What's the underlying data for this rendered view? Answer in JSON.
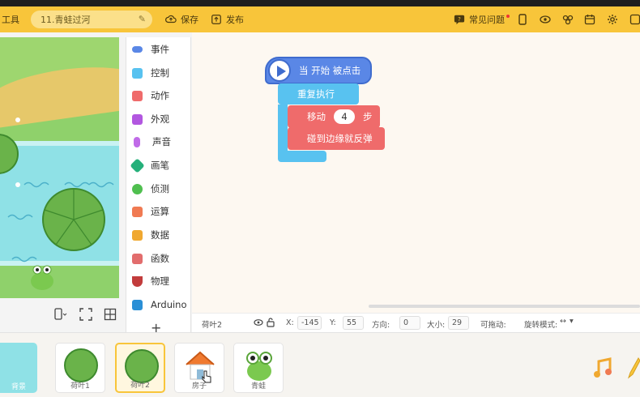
{
  "toolbar": {
    "tools_label": "工具",
    "project_name": "11.青蛙过河",
    "save_label": "保存",
    "publish_label": "发布",
    "faq_label": "常见问题"
  },
  "categories": [
    {
      "label": "事件",
      "color": "#5a87e6"
    },
    {
      "label": "控制",
      "color": "#58c2f0"
    },
    {
      "label": "动作",
      "color": "#ef6b6b"
    },
    {
      "label": "外观",
      "color": "#b257e0"
    },
    {
      "label": "声音",
      "color": "#c06be8"
    },
    {
      "label": "画笔",
      "color": "#25b07a"
    },
    {
      "label": "侦测",
      "color": "#4fbf4f"
    },
    {
      "label": "运算",
      "color": "#f07a52"
    },
    {
      "label": "数据",
      "color": "#f0a830"
    },
    {
      "label": "函数",
      "color": "#e26d6d"
    },
    {
      "label": "物理",
      "color": "#c23c3c"
    },
    {
      "label": "Arduino",
      "color": "#2a8fd6"
    }
  ],
  "blocks": {
    "when_start": "当 开始 被点击",
    "repeat": "重复执行",
    "move_prefix": "移动",
    "move_steps": "4",
    "move_suffix": "步",
    "bounce": "碰到边缘就反弹"
  },
  "properties": {
    "sprite_name": "荷叶2",
    "x_label": "X:",
    "x_value": "-145",
    "y_label": "Y:",
    "y_value": "55",
    "direction_label": "方向:",
    "direction_value": "0",
    "size_label": "大小:",
    "size_value": "29",
    "draggable_label": "可拖动:",
    "rotation_label": "旋转模式:",
    "rotation_value": "↔"
  },
  "sprites": [
    {
      "name": "荷叶1",
      "selected": false
    },
    {
      "name": "荷叶2",
      "selected": true
    },
    {
      "name": "房子",
      "selected": false
    },
    {
      "name": "青蛙",
      "selected": false
    }
  ],
  "background_thumb": {
    "name": "背景"
  },
  "colors": {
    "toolbar": "#f8c53a",
    "event_block": "#5a87e6",
    "control_block": "#58c2f0",
    "motion_block": "#ef6b6b"
  }
}
